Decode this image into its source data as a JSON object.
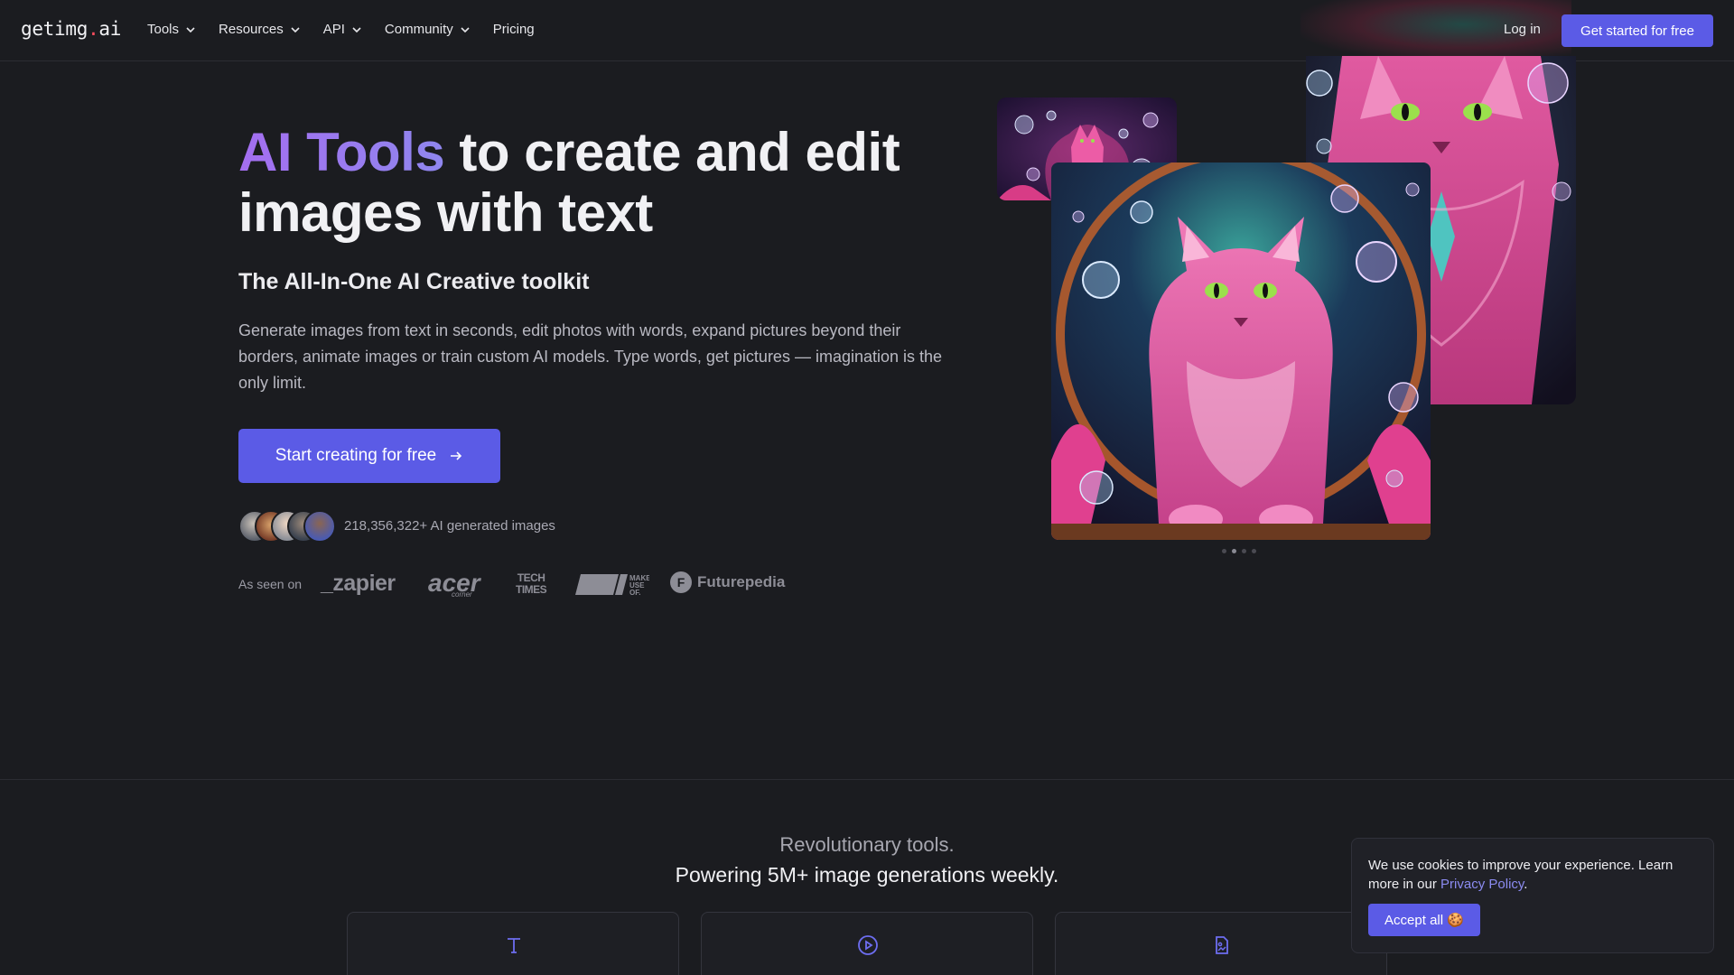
{
  "nav": {
    "logo_prefix": "getimg",
    "logo_dot": ".",
    "logo_suffix": "ai",
    "items": [
      {
        "label": "Tools",
        "dropdown": true
      },
      {
        "label": "Resources",
        "dropdown": true
      },
      {
        "label": "API",
        "dropdown": true
      },
      {
        "label": "Community",
        "dropdown": true
      },
      {
        "label": "Pricing",
        "dropdown": false
      }
    ],
    "login_label": "Log in",
    "get_started_label": "Get started for free"
  },
  "hero": {
    "title_accent": "AI Tools",
    "title_rest": " to create and edit images with text",
    "subtitle": "The All-In-One AI Creative toolkit",
    "description": "Generate images from text in seconds, edit photos with words, expand pictures beyond their borders, animate images or train custom AI models. Type words, get pictures — imagination is the only limit.",
    "cta_label": "Start creating for free",
    "counter_text": "218,356,322+ AI generated images",
    "as_seen_on_label": "As seen on",
    "brands": {
      "zapier": "_zapier",
      "acer": "acer",
      "acer_sub": "corner",
      "techtimes_line1": "TECH",
      "techtimes_line2": "TIMES",
      "makeuseof": "MAKE USE OF.",
      "futurepedia": "Futurepedia",
      "futurepedia_mark": "F"
    }
  },
  "carousel": {
    "count": 4,
    "active": 1
  },
  "section2": {
    "line1": "Revolutionary tools.",
    "line2": "Powering 5M+ image generations weekly."
  },
  "tools": [
    {
      "icon": "text-icon"
    },
    {
      "icon": "play-circle-icon"
    },
    {
      "icon": "image-edit-icon"
    }
  ],
  "cookie": {
    "text_before": "We use cookies to improve your experience. Learn more in our ",
    "link": "Privacy Policy",
    "text_after": ".",
    "accept_label": "Accept all 🍪"
  },
  "colors": {
    "accent": "#5b5be6",
    "background": "#1b1c20",
    "title_gradient_start": "#a46ef0",
    "logo_dot": "#ff4d5e"
  }
}
